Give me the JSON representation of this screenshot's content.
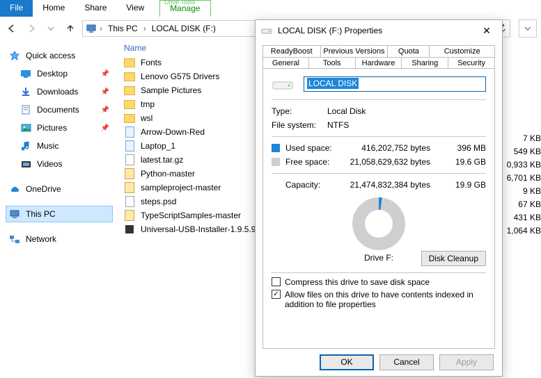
{
  "ribbon": {
    "file": "File",
    "home": "Home",
    "share": "Share",
    "view": "View",
    "tools_context": "Drive Tools",
    "manage": "Manage"
  },
  "breadcrumb": {
    "root": "This PC",
    "leaf": "LOCAL DISK (F:)"
  },
  "sidebar": {
    "quick": "Quick access",
    "desktop": "Desktop",
    "downloads": "Downloads",
    "documents": "Documents",
    "pictures": "Pictures",
    "music": "Music",
    "videos": "Videos",
    "onedrive": "OneDrive",
    "thispc": "This PC",
    "network": "Network"
  },
  "columns": {
    "name": "Name"
  },
  "files": [
    {
      "name": "Fonts",
      "type": "folder"
    },
    {
      "name": "Lenovo G575 Drivers",
      "type": "folder"
    },
    {
      "name": "Sample Pictures",
      "type": "folder"
    },
    {
      "name": "tmp",
      "type": "folder"
    },
    {
      "name": "wsl",
      "type": "folder"
    },
    {
      "name": "Arrow-Down-Red",
      "type": "bmp"
    },
    {
      "name": "Laptop_1",
      "type": "bmp"
    },
    {
      "name": "latest.tar.gz",
      "type": "file"
    },
    {
      "name": "Python-master",
      "type": "zip"
    },
    {
      "name": "sampleproject-master",
      "type": "zip"
    },
    {
      "name": "steps.psd",
      "type": "file"
    },
    {
      "name": "TypeScriptSamples-master",
      "type": "zip"
    },
    {
      "name": "Universal-USB-Installer-1.9.5.9",
      "type": "exe"
    }
  ],
  "sizes_visible": [
    "7 KB",
    "549 KB",
    "0,933 KB",
    "6,701 KB",
    "9 KB",
    "67 KB",
    "431 KB",
    "1,064 KB"
  ],
  "dlg": {
    "title": "LOCAL DISK (F:) Properties",
    "tabs_row1": [
      "ReadyBoost",
      "Previous Versions",
      "Quota",
      "Customize"
    ],
    "tabs_row2": [
      "General",
      "Tools",
      "Hardware",
      "Sharing",
      "Security"
    ],
    "volume_name": "LOCAL DISK",
    "type_label": "Type:",
    "type_value": "Local Disk",
    "fs_label": "File system:",
    "fs_value": "NTFS",
    "used_label": "Used space:",
    "used_bytes": "416,202,752 bytes",
    "used_hr": "396 MB",
    "free_label": "Free space:",
    "free_bytes": "21,058,629,632 bytes",
    "free_hr": "19.6 GB",
    "cap_label": "Capacity:",
    "cap_bytes": "21,474,832,384 bytes",
    "cap_hr": "19.9 GB",
    "drive_letter": "Drive F:",
    "cleanup": "Disk Cleanup",
    "compress": "Compress this drive to save disk space",
    "index": "Allow files on this drive to have contents indexed in addition to file properties",
    "ok": "OK",
    "cancel": "Cancel",
    "apply": "Apply"
  }
}
